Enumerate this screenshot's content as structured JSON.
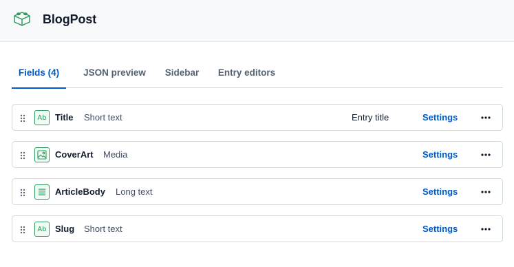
{
  "header": {
    "title": "BlogPost",
    "logo_icon": "content-type-cube-icon"
  },
  "tabs": [
    {
      "label": "Fields (4)",
      "active": true
    },
    {
      "label": "JSON preview",
      "active": false
    },
    {
      "label": "Sidebar",
      "active": false
    },
    {
      "label": "Entry editors",
      "active": false
    }
  ],
  "fields": [
    {
      "name": "Title",
      "type": "Short text",
      "icon": "short-text-icon",
      "entry_title": "Entry title",
      "settings_label": "Settings"
    },
    {
      "name": "CoverArt",
      "type": "Media",
      "icon": "media-icon",
      "entry_title": "",
      "settings_label": "Settings"
    },
    {
      "name": "ArticleBody",
      "type": "Long text",
      "icon": "long-text-icon",
      "entry_title": "",
      "settings_label": "Settings"
    },
    {
      "name": "Slug",
      "type": "Short text",
      "icon": "short-text-icon",
      "entry_title": "",
      "settings_label": "Settings"
    }
  ],
  "colors": {
    "accent": "#0059c8",
    "field_icon": "#2b9a5c",
    "header_bg": "#f7f9fa"
  }
}
